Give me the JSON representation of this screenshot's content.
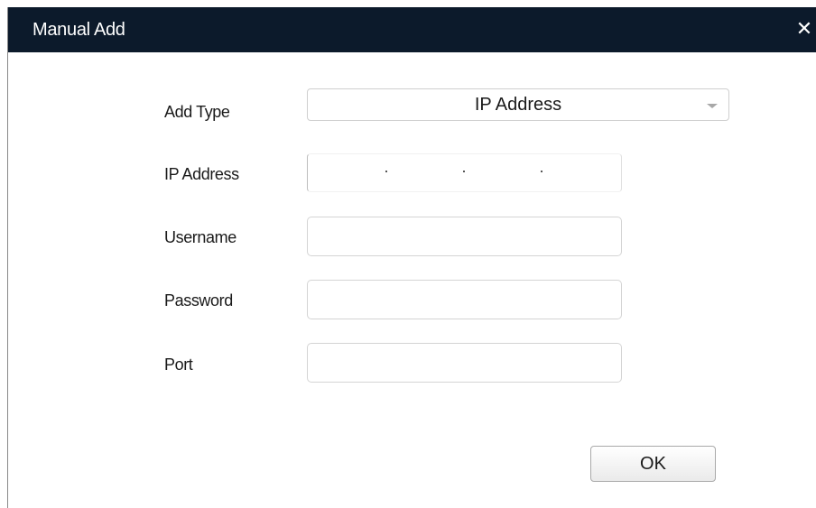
{
  "dialog": {
    "title": "Manual Add",
    "close_glyph": "✕"
  },
  "form": {
    "add_type": {
      "label": "Add Type",
      "selected": "IP Address"
    },
    "ip_address": {
      "label": "IP Address",
      "value": "",
      "separator": "."
    },
    "username": {
      "label": "Username",
      "value": ""
    },
    "password": {
      "label": "Password",
      "value": ""
    },
    "port": {
      "label": "Port",
      "value": ""
    }
  },
  "actions": {
    "ok_label": "OK"
  },
  "colors": {
    "titlebar": "#0c1a2b",
    "title_text": "#ffffff",
    "input_border": "#d4d4d4"
  },
  "icons": {
    "close": "close-icon",
    "dropdown": "chevron-down-icon"
  }
}
